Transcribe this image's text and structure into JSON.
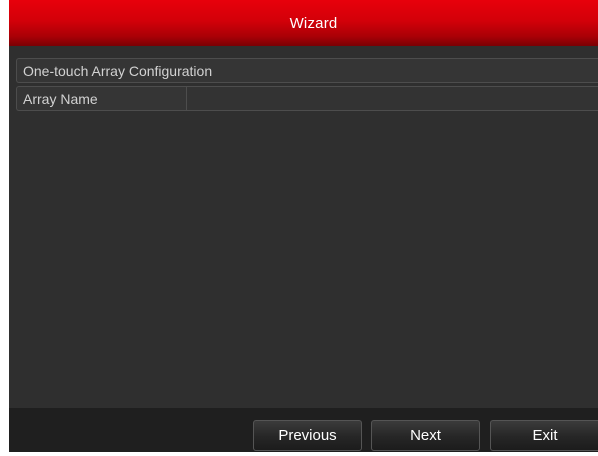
{
  "window": {
    "title": "Wizard"
  },
  "config": {
    "section_label": "One-touch Array Configuration",
    "array_name_label": "Array Name",
    "array_name_value": ""
  },
  "footer": {
    "previous_label": "Previous",
    "next_label": "Next",
    "exit_label": "Exit"
  },
  "colors": {
    "title_bar": "#d30009",
    "panel_background": "#2f2f2f",
    "footer_background": "#1f1f1f",
    "text": "#d2d2d2"
  }
}
